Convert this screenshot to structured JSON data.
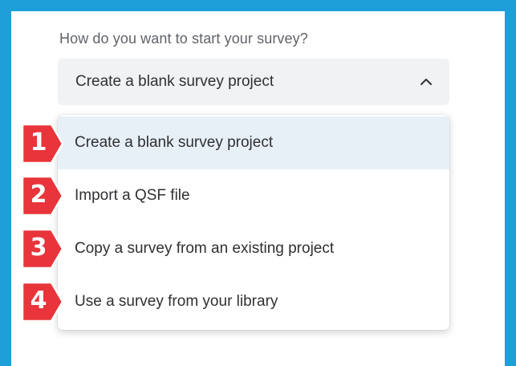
{
  "question": "How do you want to start your survey?",
  "select": {
    "value": "Create a blank survey project",
    "icon": "chevron-up-icon"
  },
  "options": [
    {
      "label": "Create a blank survey project",
      "selected": true
    },
    {
      "label": "Import a QSF file",
      "selected": false
    },
    {
      "label": "Copy a survey from an existing project",
      "selected": false
    },
    {
      "label": "Use a survey from your library",
      "selected": false
    }
  ],
  "badges": [
    "1",
    "2",
    "3",
    "4"
  ],
  "colors": {
    "frame": "#1f9fd9",
    "badge": "#e8343a",
    "selected_bg": "#e8f0f7",
    "select_bg": "#f1f2f3"
  }
}
